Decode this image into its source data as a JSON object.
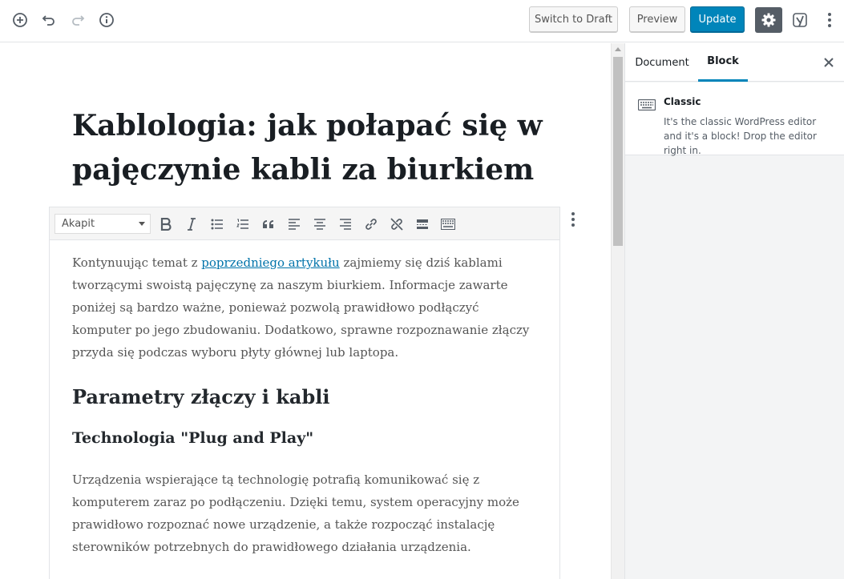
{
  "topbar": {
    "switch_draft_label": "Switch to Draft",
    "preview_label": "Preview",
    "update_label": "Update",
    "icons": [
      "add-block-icon",
      "undo-icon",
      "redo-icon",
      "info-icon",
      "gear-icon",
      "yoast-icon",
      "more-vertical-icon"
    ]
  },
  "post": {
    "title": "Kablologia: jak połapać się w pajęczynie kabli za biurkiem"
  },
  "classic_toolbar": {
    "format_value": "Akapit",
    "tools": [
      "bold-icon",
      "italic-icon",
      "bullet-list-icon",
      "numbered-list-icon",
      "blockquote-icon",
      "align-left-icon",
      "align-center-icon",
      "align-right-icon",
      "link-icon",
      "unlink-icon",
      "read-more-icon",
      "toolbar-toggle-icon"
    ]
  },
  "content": {
    "p1_before_link": "Kontynuując temat z ",
    "p1_link": "poprzedniego artykułu",
    "p1_after_link": " zajmiemy się dziś kablami tworzącymi swoistą pajęczynę za naszym biurkiem. Informacje zawarte poniżej są bardzo ważne, ponieważ pozwolą prawidłowo podłączyć komputer po jego zbudowaniu. Dodatkowo, sprawne rozpoznawanie złączy przyda się podczas wyboru płyty głównej lub laptopa.",
    "h2": "Parametry złączy i kabli",
    "h3": "Technologia \"Plug and Play\"",
    "p2": "Urządzenia wspierające tą technologię potrafią komunikować się z komputerem zaraz po podłączeniu. Dzięki temu, system operacyjny może prawidłowo rozpoznać nowe urządzenie, a także rozpocząć instalację sterowników potrzebnych do prawidłowego działania urządzenia."
  },
  "sidebar": {
    "tab_document": "Document",
    "tab_block": "Block",
    "active_tab": "Block",
    "block_name": "Classic",
    "block_description": "It's the classic WordPress editor and it's a block! Drop the editor right in."
  },
  "colors": {
    "primary": "#0085ba",
    "link": "#0073aa",
    "settings_bg": "#555d66"
  }
}
